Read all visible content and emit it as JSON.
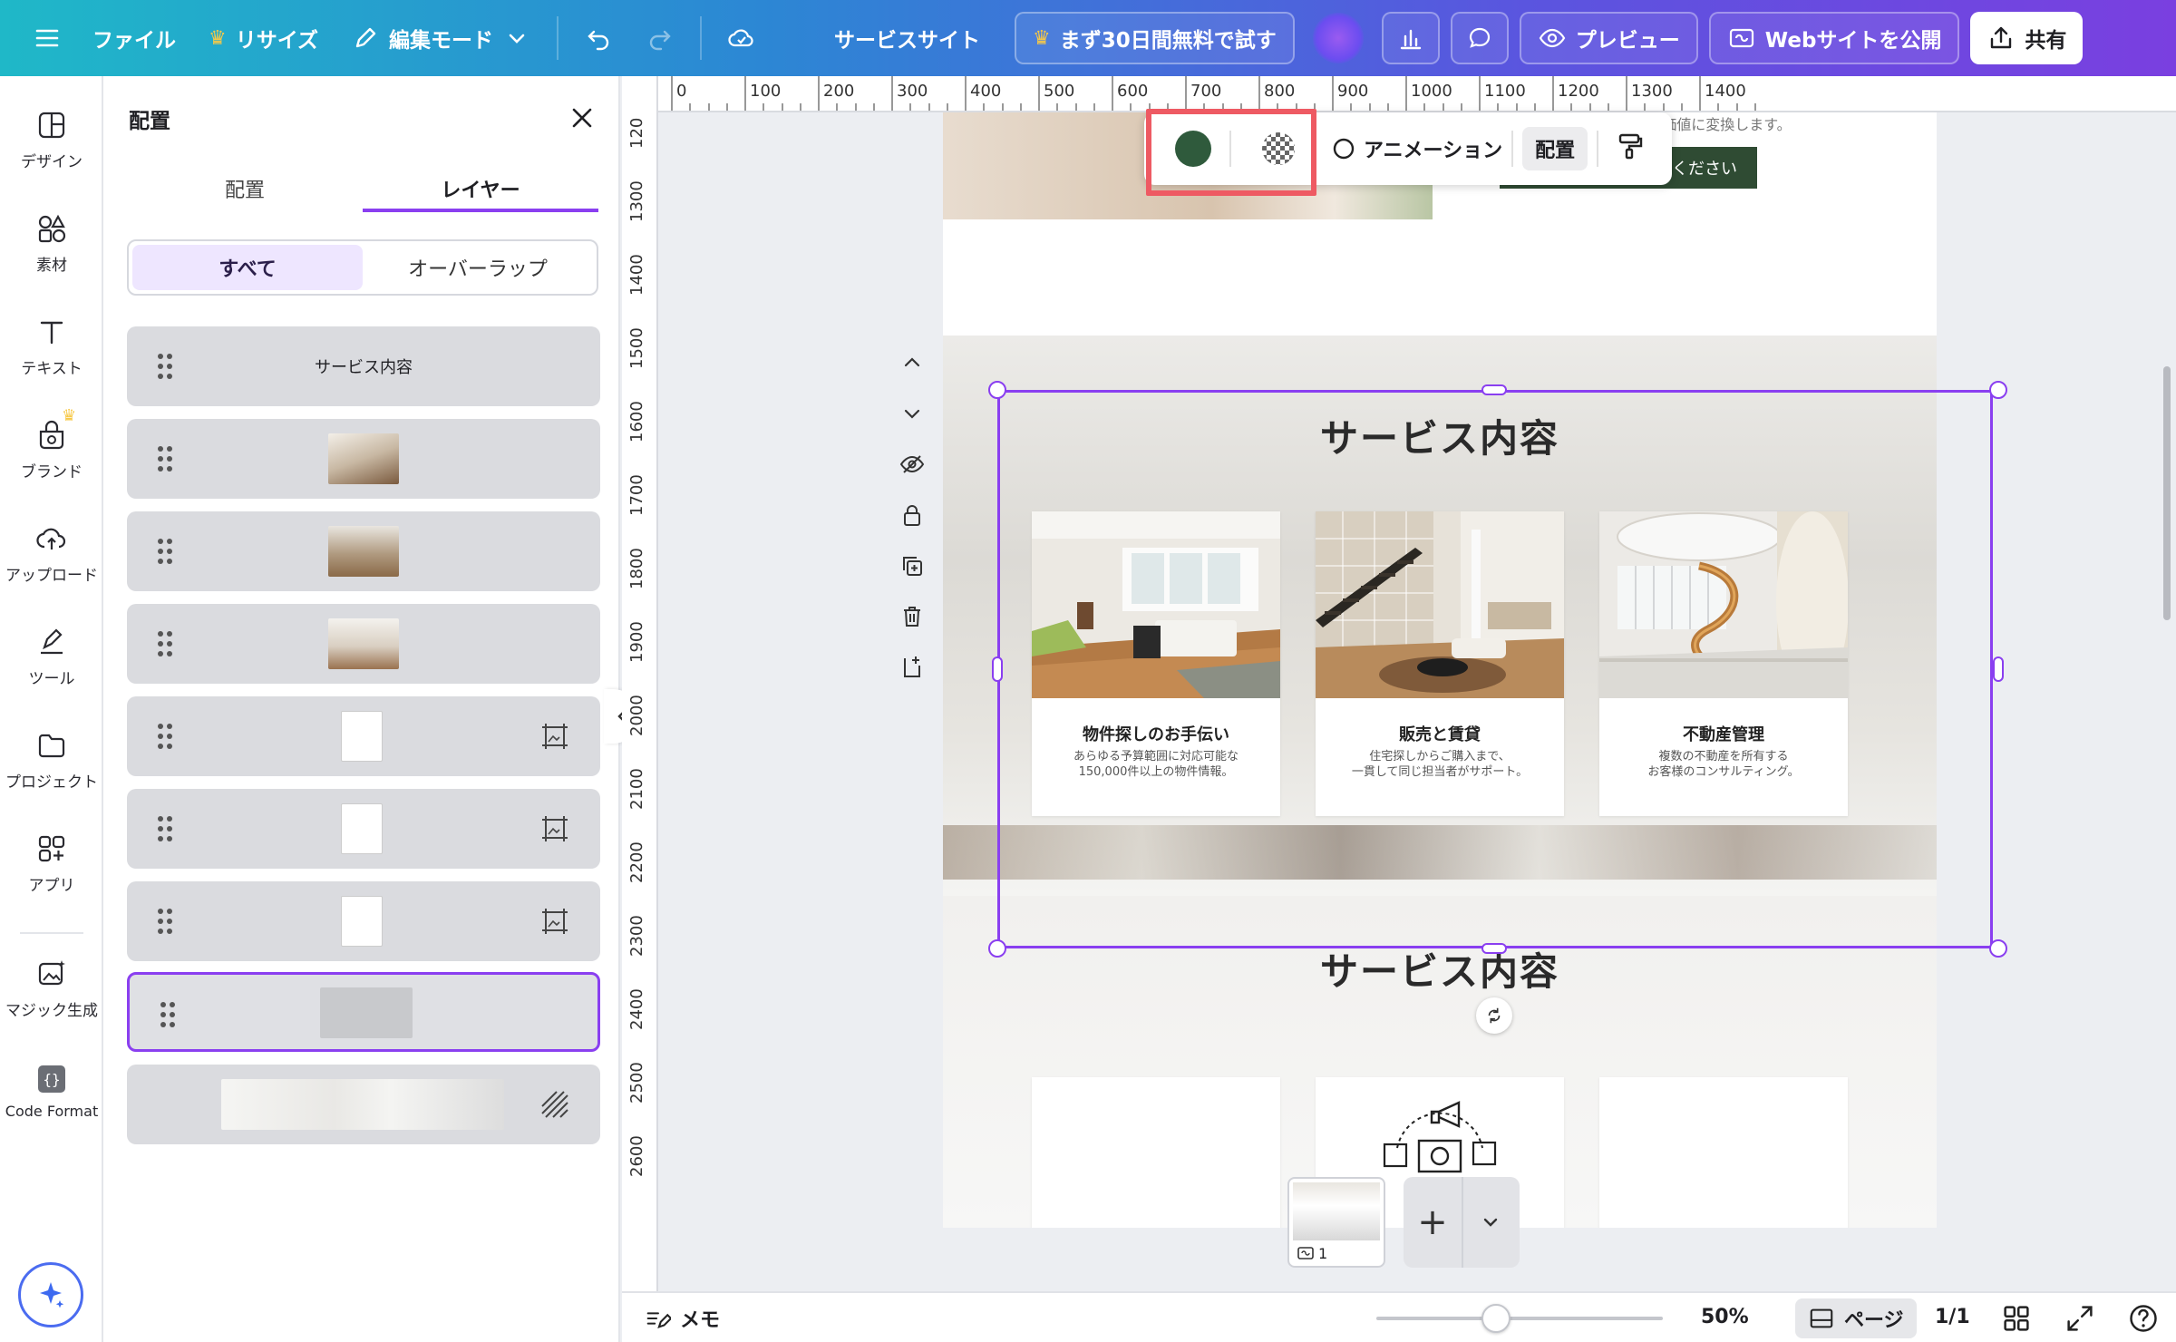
{
  "topbar": {
    "file": "ファイル",
    "resize": "リサイズ",
    "edit_mode": "編集モード",
    "site_name": "サービスサイト",
    "trial": "まず30日間無料で試す",
    "preview": "プレビュー",
    "publish": "Webサイトを公開",
    "share": "共有"
  },
  "rail": {
    "design": "デザイン",
    "elements": "素材",
    "text": "テキスト",
    "brand": "ブランド",
    "uploads": "アップロード",
    "tools": "ツール",
    "projects": "プロジェクト",
    "apps": "アプリ",
    "magic": "マジック生成",
    "code_format": "Code Format"
  },
  "panel": {
    "title": "配置",
    "tabs": [
      "配置",
      "レイヤー"
    ],
    "active_tab": "レイヤー",
    "filters": [
      "すべて",
      "オーバーラップ"
    ],
    "layer_text": "サービス内容"
  },
  "ruler": {
    "top": [
      "0",
      "100",
      "200",
      "300",
      "400",
      "500",
      "600",
      "700",
      "800",
      "900",
      "1000",
      "1100",
      "1200",
      "1300",
      "1400"
    ],
    "left": [
      "120",
      "1300",
      "1400",
      "1500",
      "1600",
      "1700",
      "1800",
      "1900",
      "2000",
      "2100",
      "2200",
      "2300",
      "2400",
      "2500",
      "2600"
    ]
  },
  "toolbar": {
    "animation": "アニメーション",
    "position": "配置",
    "fill_color": "#2f5a3c"
  },
  "page": {
    "hero_button": "ください",
    "hero_tiny": "形にし、確かな成果へと価値に変換します。",
    "section_title": "サービス内容",
    "cards": [
      {
        "title": "物件探しのお手伝い",
        "desc1": "あらゆる予算範囲に対応可能な",
        "desc2": "150,000件以上の物件情報。"
      },
      {
        "title": "販売と賃貸",
        "desc1": "住宅探しからご購入まで、",
        "desc2": "一貫して同じ担当者がサポート。"
      },
      {
        "title": "不動産管理",
        "desc1": "複数の不動産を所有する",
        "desc2": "お客様のコンサルティング。"
      }
    ],
    "section2_title": "サービス内容"
  },
  "bottombar": {
    "memo": "メモ",
    "zoom": "50%",
    "page": "ページ",
    "count": "1/1",
    "thumb_page_number": "1"
  },
  "colors": {
    "accent": "#8a3ff0",
    "highlight": "#ee5a63"
  }
}
